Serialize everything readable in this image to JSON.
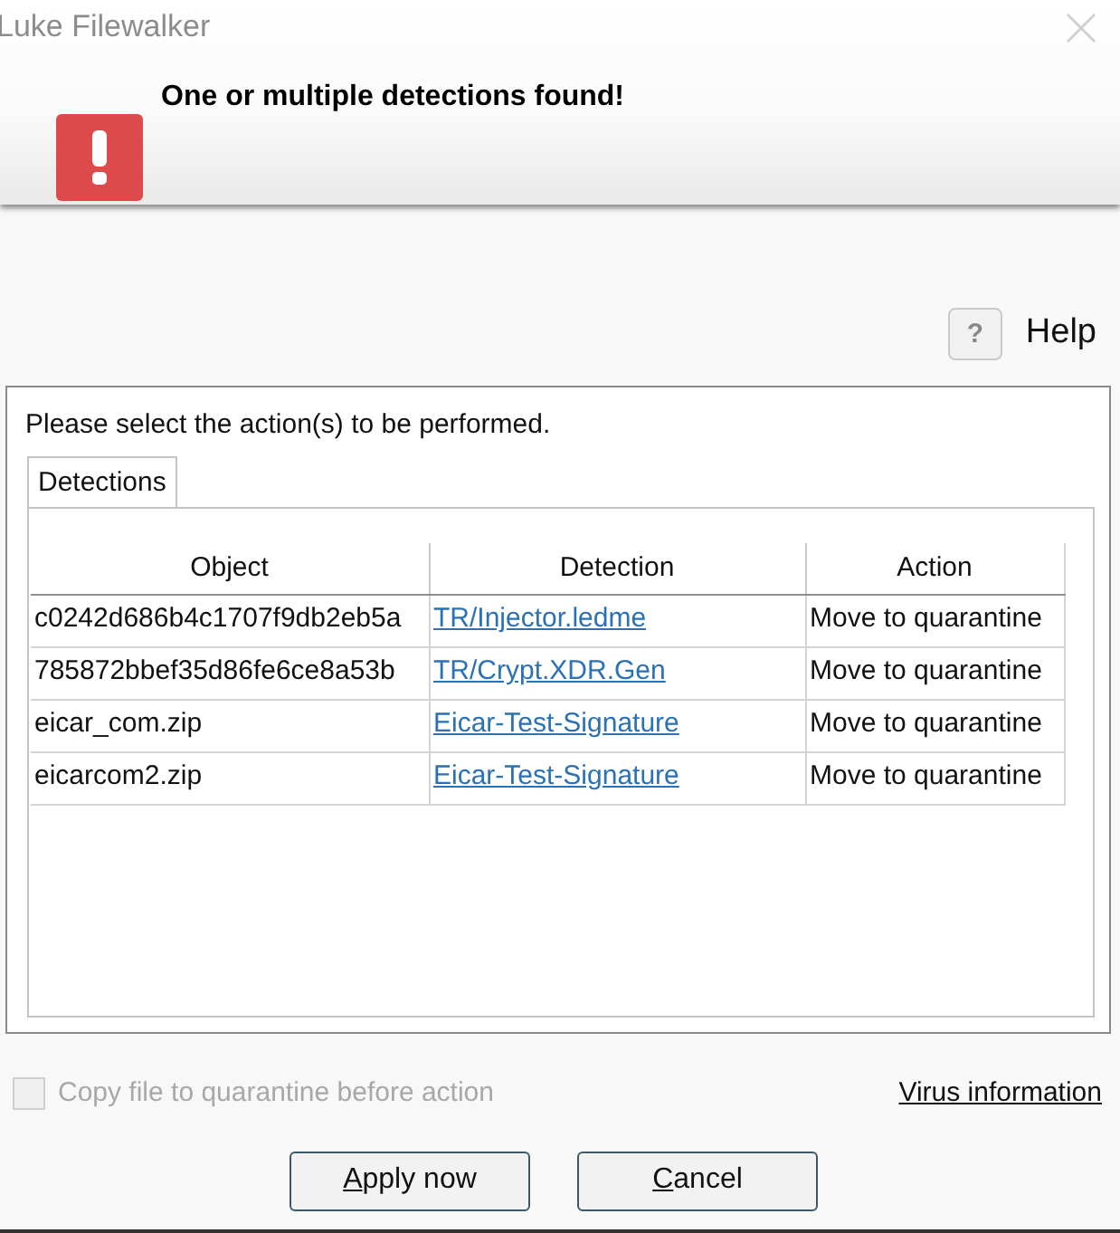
{
  "window": {
    "title": "Luke Filewalker"
  },
  "header": {
    "message": "One or multiple detections found!"
  },
  "help": {
    "button": "?",
    "label": "Help"
  },
  "detections_panel": {
    "instruction": "Please select the action(s) to be performed.",
    "tabs": [
      {
        "label": "Detections",
        "selected": true
      }
    ],
    "table": {
      "columns": [
        "Object",
        "Detection",
        "Action"
      ],
      "rows": [
        {
          "object": "c0242d686b4c1707f9db2eb5a",
          "detection": "TR/Injector.ledme",
          "action": "Move to quarantine"
        },
        {
          "object": "785872bbef35d86fe6ce8a53b",
          "detection": "TR/Crypt.XDR.Gen",
          "action": "Move to quarantine"
        },
        {
          "object": "eicar_com.zip",
          "detection": "Eicar-Test-Signature",
          "action": "Move to quarantine"
        },
        {
          "object": "eicarcom2.zip",
          "detection": "Eicar-Test-Signature",
          "action": "Move to quarantine"
        }
      ]
    }
  },
  "copy_option": {
    "label": "Copy file to quarantine before action",
    "checked": false,
    "disabled": true
  },
  "virus_information_link": "Virus information",
  "buttons": [
    {
      "label": "Apply now"
    },
    {
      "label": "Cancel"
    }
  ]
}
